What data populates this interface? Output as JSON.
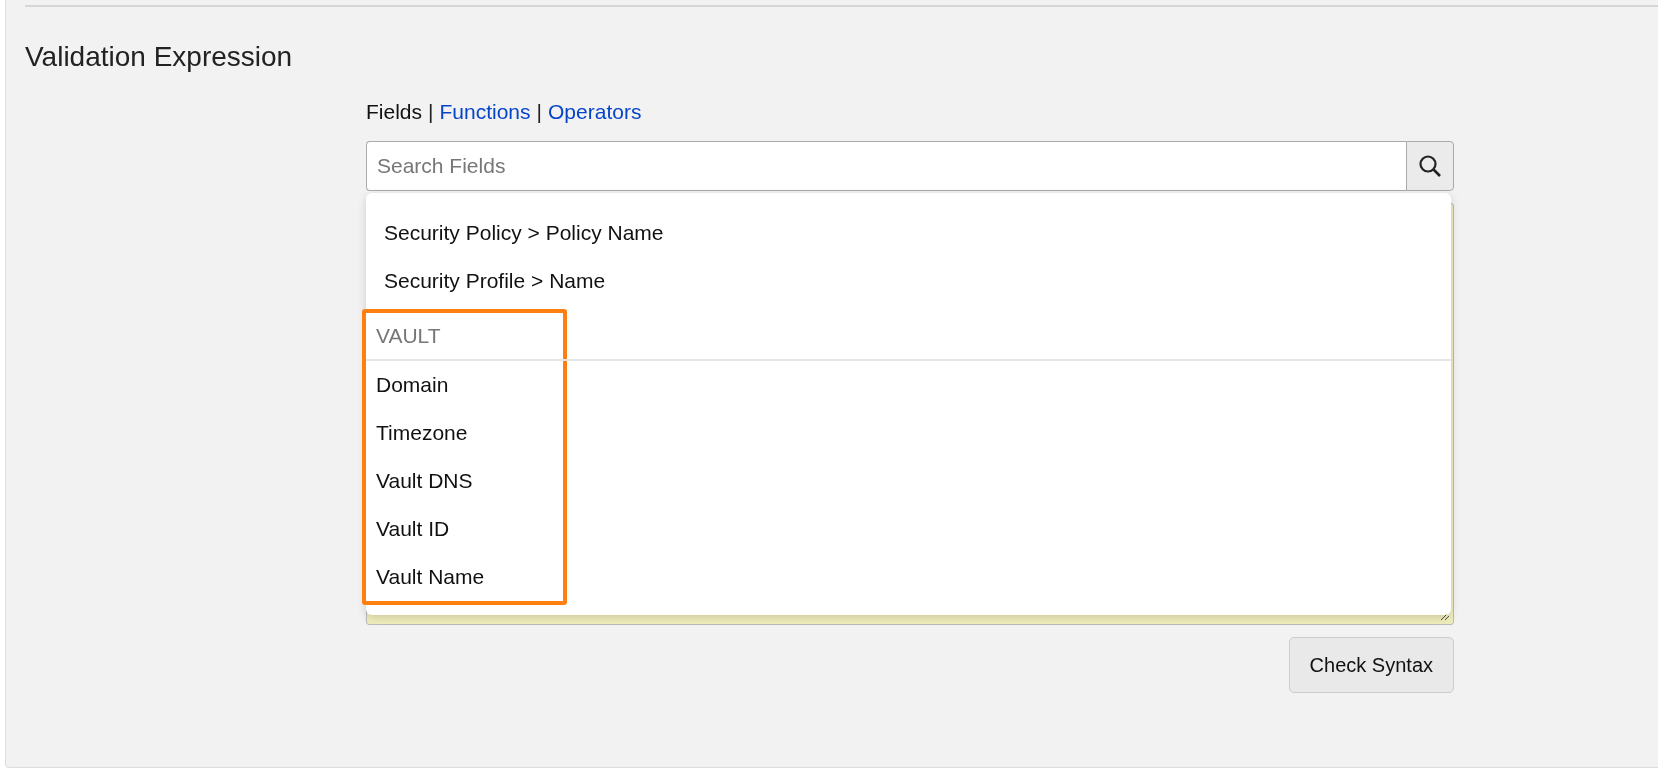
{
  "section_title": "Validation Expression",
  "tabs": [
    {
      "label": "Fields",
      "selected": true
    },
    {
      "label": "Functions",
      "selected": false
    },
    {
      "label": "Operators",
      "selected": false
    }
  ],
  "tab_separator": "|",
  "search": {
    "placeholder": "Search Fields"
  },
  "dropdown": {
    "groups": [
      {
        "highlighted": false,
        "items": [
          "Security Policy > Policy Name",
          "Security Profile > Name"
        ]
      },
      {
        "highlighted": true,
        "header": "VAULT",
        "items": [
          "Domain",
          "Timezone",
          "Vault DNS",
          "Vault ID",
          "Vault Name"
        ]
      }
    ]
  },
  "check_button": "Check Syntax"
}
